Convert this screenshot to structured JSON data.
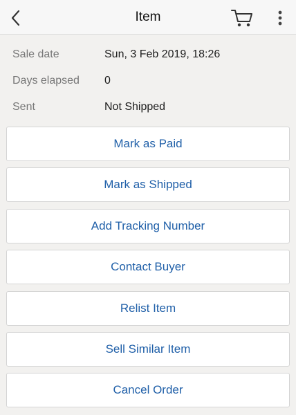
{
  "header": {
    "title": "Item"
  },
  "details": [
    {
      "label": "Sale date",
      "value": "Sun, 3 Feb 2019, 18:26"
    },
    {
      "label": "Days elapsed",
      "value": "0"
    },
    {
      "label": "Sent",
      "value": "Not Shipped"
    }
  ],
  "actions": [
    {
      "label": "Mark as Paid"
    },
    {
      "label": "Mark as Shipped"
    },
    {
      "label": "Add Tracking Number"
    },
    {
      "label": "Contact Buyer"
    },
    {
      "label": "Relist Item"
    },
    {
      "label": "Sell Similar Item"
    },
    {
      "label": "Cancel Order"
    }
  ],
  "colors": {
    "accent": "#1f5fa8",
    "background": "#f2f1ef"
  },
  "icons": {
    "back": "chevron-left-icon",
    "cart": "cart-icon",
    "more": "more-vertical-icon"
  }
}
